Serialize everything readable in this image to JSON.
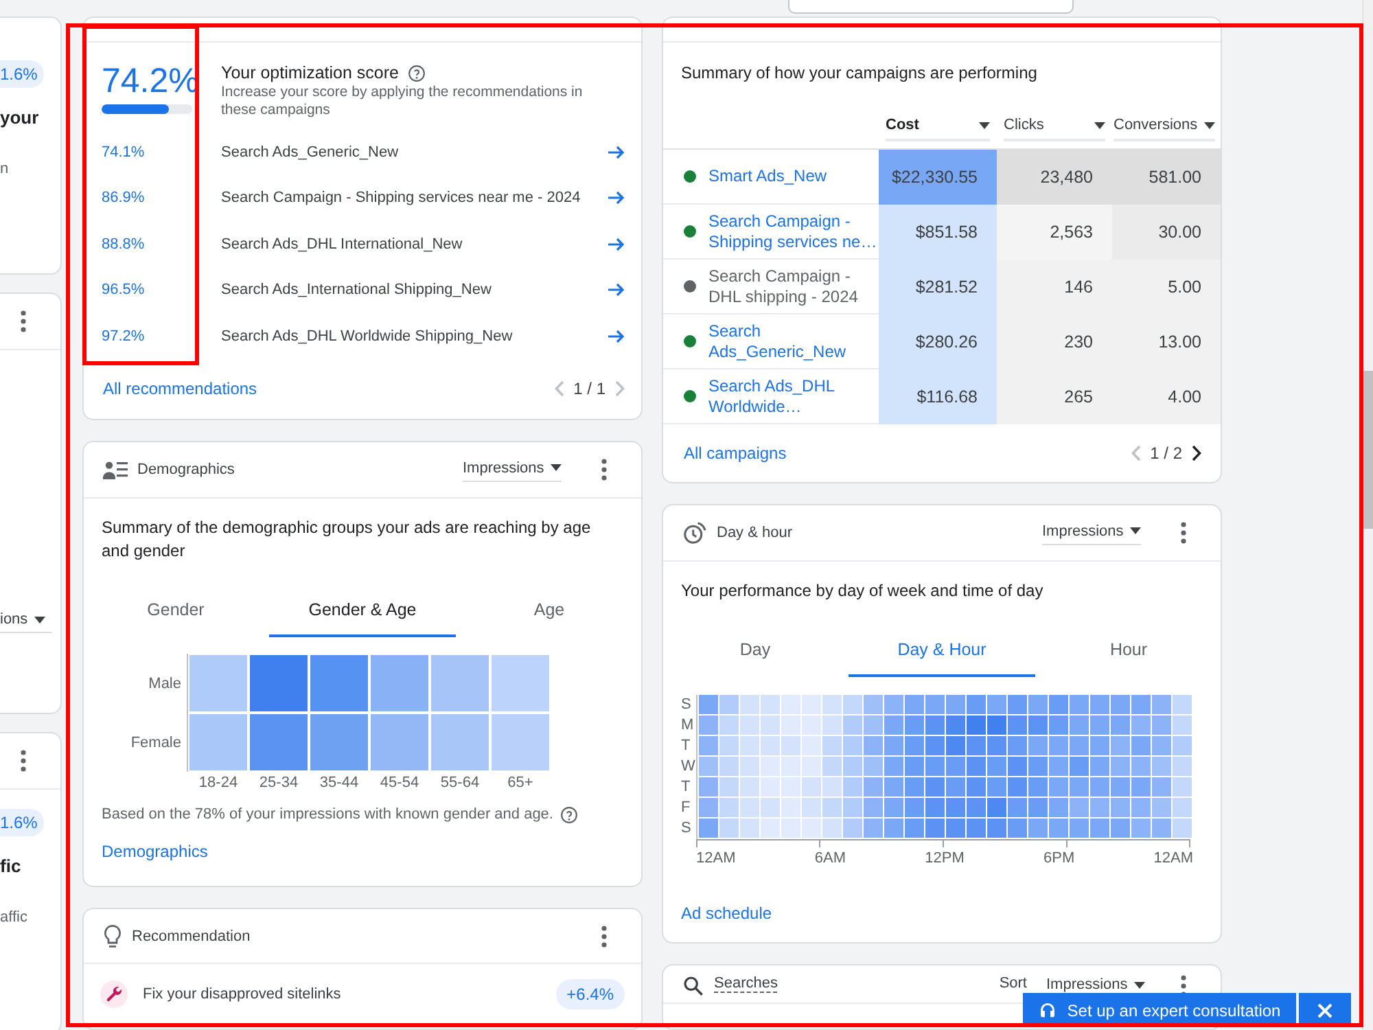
{
  "highlight_frame": true,
  "left_cards": [
    {
      "menu": false,
      "chip": "1.6%",
      "title": "your",
      "text": "n"
    },
    {
      "menu": true,
      "dropdown": "ions"
    },
    {
      "menu": true,
      "chip": "1.6%",
      "title": "fic",
      "text": "affic"
    }
  ],
  "optimization": {
    "score": "74.2%",
    "level": 0.742,
    "score_column_highlighted": true,
    "title": "Your optimization score",
    "subtitle": "Increase your score by applying the recommendations in these campaigns",
    "campaigns": [
      {
        "score": "74.1%",
        "name": "Search Ads_Generic_New"
      },
      {
        "score": "86.9%",
        "name": "Search Campaign - Shipping services near me - 2024"
      },
      {
        "score": "88.8%",
        "name": "Search Ads_DHL International_New"
      },
      {
        "score": "96.5%",
        "name": "Search Ads_International Shipping_New"
      },
      {
        "score": "97.2%",
        "name": "Search Ads_DHL Worldwide Shipping_New"
      }
    ],
    "link": "All recommendations",
    "pager": {
      "text": "1 / 1",
      "prev_disabled": true,
      "next_disabled": true
    }
  },
  "demographics": {
    "title": "Demographics",
    "metric": "Impressions",
    "summary": "Summary of the demographic groups your ads are reaching by age and gender",
    "tabs": [
      {
        "label": "Gender",
        "selected": false
      },
      {
        "label": "Gender & Age",
        "selected": true
      },
      {
        "label": "Age",
        "selected": false
      }
    ],
    "heatmap": {
      "rows": [
        {
          "label": "Male",
          "cells": [
            {
              "color": "#aecbfa"
            },
            {
              "color": "#3f80ee"
            },
            {
              "color": "#5592f1"
            },
            {
              "color": "#89b1f5"
            },
            {
              "color": "#a6c4f8"
            },
            {
              "color": "#bcd4fb"
            }
          ]
        },
        {
          "label": "Female",
          "cells": [
            {
              "color": "#a9c7f9"
            },
            {
              "color": "#5a93f1"
            },
            {
              "color": "#6fa1f3"
            },
            {
              "color": "#94b8f6"
            },
            {
              "color": "#a8c6f8"
            },
            {
              "color": "#b9d1fa"
            }
          ]
        }
      ],
      "columns": [
        "18-24",
        "25-34",
        "35-44",
        "45-54",
        "55-64",
        "65+"
      ]
    },
    "note": "Based on the 78% of your impressions with known gender and age.",
    "link": "Demographics"
  },
  "recommendation": {
    "title": "Recommendation",
    "items": [
      {
        "text": "Fix your disapproved sitelinks",
        "uplift": "+6.4%"
      }
    ]
  },
  "campaigns": {
    "summary": "Summary of how your campaigns are performing",
    "columns": [
      {
        "label": "Cost",
        "sorted": true
      },
      {
        "label": "Clicks",
        "sorted": false
      },
      {
        "label": "Conversions",
        "sorted": false
      }
    ],
    "rows": [
      {
        "name": "Smart Ads_New",
        "color": "#188038",
        "link": true,
        "cells": [
          {
            "value": "$22,330.55",
            "color": "#78a8f5"
          },
          {
            "value": "23,480",
            "color": "#dedede"
          },
          {
            "value": "581.00",
            "color": "#dedede"
          }
        ]
      },
      {
        "name": "Search Campaign - Shipping services ne…",
        "color": "#188038",
        "link": true,
        "cells": [
          {
            "value": "$851.58",
            "color": "#d2e3fc"
          },
          {
            "value": "2,563",
            "color": "#f4f4f4"
          },
          {
            "value": "30.00",
            "color": "#ebebeb"
          }
        ]
      },
      {
        "name": "Search Campaign - DHL shipping - 2024",
        "color": "#5f6368",
        "link": false,
        "cells": [
          {
            "value": "$281.52",
            "color": "#d2e3fc"
          },
          {
            "value": "146",
            "color": "#f1f1f1"
          },
          {
            "value": "5.00",
            "color": "#f1f1f1"
          }
        ]
      },
      {
        "name": "Search Ads_Generic_New",
        "color": "#188038",
        "link": true,
        "cells": [
          {
            "value": "$280.26",
            "color": "#d2e3fc"
          },
          {
            "value": "230",
            "color": "#f1f1f1"
          },
          {
            "value": "13.00",
            "color": "#f1f1f1"
          }
        ]
      },
      {
        "name": "Search Ads_DHL Worldwide…",
        "color": "#188038",
        "link": true,
        "cells": [
          {
            "value": "$116.68",
            "color": "#d2e3fc"
          },
          {
            "value": "265",
            "color": "#f1f1f1"
          },
          {
            "value": "4.00",
            "color": "#f1f1f1"
          }
        ]
      }
    ],
    "link": "All campaigns",
    "pager": {
      "text": "1 / 2",
      "prev_disabled": true,
      "next_disabled": false
    }
  },
  "day_hour": {
    "title": "Day & hour",
    "metric": "Impressions",
    "summary": "Your performance by day of week and time of day",
    "tabs": [
      {
        "label": "Day",
        "selected": false
      },
      {
        "label": "Day & Hour",
        "selected": true
      },
      {
        "label": "Hour",
        "selected": false
      }
    ],
    "heatmap": {
      "rows": [
        {
          "label": "S",
          "cells": [
            {
              "color": "#7aa7f6"
            },
            {
              "color": "#b1cbfa"
            },
            {
              "color": "#d4e2fc"
            },
            {
              "color": "#d4e2fc"
            },
            {
              "color": "#e1ebfd"
            },
            {
              "color": "#e1ebfd"
            },
            {
              "color": "#d4e2fc"
            },
            {
              "color": "#c4d8fb"
            },
            {
              "color": "#9fbff9"
            },
            {
              "color": "#8cb3f8"
            },
            {
              "color": "#7aa7f6"
            },
            {
              "color": "#7aa7f6"
            },
            {
              "color": "#7aa7f6"
            },
            {
              "color": "#699cf5"
            },
            {
              "color": "#7aa7f6"
            },
            {
              "color": "#699cf5"
            },
            {
              "color": "#7aa7f6"
            },
            {
              "color": "#699cf5"
            },
            {
              "color": "#7aa7f6"
            },
            {
              "color": "#7aa7f6"
            },
            {
              "color": "#7aa7f6"
            },
            {
              "color": "#7aa7f6"
            },
            {
              "color": "#8cb3f8"
            },
            {
              "color": "#c4d8fb"
            }
          ]
        },
        {
          "label": "M",
          "cells": [
            {
              "color": "#8cb3f8"
            },
            {
              "color": "#c4d8fb"
            },
            {
              "color": "#d4e2fc"
            },
            {
              "color": "#d4e2fc"
            },
            {
              "color": "#e1ebfd"
            },
            {
              "color": "#e1ebfd"
            },
            {
              "color": "#d4e2fc"
            },
            {
              "color": "#b1cbfa"
            },
            {
              "color": "#9fbff9"
            },
            {
              "color": "#7aa7f6"
            },
            {
              "color": "#699cf5"
            },
            {
              "color": "#5b92f3"
            },
            {
              "color": "#4d89f1"
            },
            {
              "color": "#4081ef"
            },
            {
              "color": "#4081ef"
            },
            {
              "color": "#5b92f3"
            },
            {
              "color": "#5b92f3"
            },
            {
              "color": "#699cf5"
            },
            {
              "color": "#7aa7f6"
            },
            {
              "color": "#7aa7f6"
            },
            {
              "color": "#7aa7f6"
            },
            {
              "color": "#8cb3f8"
            },
            {
              "color": "#8cb3f8"
            },
            {
              "color": "#c4d8fb"
            }
          ]
        },
        {
          "label": "T",
          "cells": [
            {
              "color": "#8cb3f8"
            },
            {
              "color": "#c4d8fb"
            },
            {
              "color": "#d4e2fc"
            },
            {
              "color": "#d4e2fc"
            },
            {
              "color": "#d4e2fc"
            },
            {
              "color": "#e1ebfd"
            },
            {
              "color": "#c4d8fb"
            },
            {
              "color": "#b1cbfa"
            },
            {
              "color": "#8cb3f8"
            },
            {
              "color": "#7aa7f6"
            },
            {
              "color": "#699cf5"
            },
            {
              "color": "#5b92f3"
            },
            {
              "color": "#4d89f1"
            },
            {
              "color": "#5b92f3"
            },
            {
              "color": "#5b92f3"
            },
            {
              "color": "#699cf5"
            },
            {
              "color": "#7aa7f6"
            },
            {
              "color": "#7aa7f6"
            },
            {
              "color": "#7aa7f6"
            },
            {
              "color": "#7aa7f6"
            },
            {
              "color": "#8cb3f8"
            },
            {
              "color": "#7aa7f6"
            },
            {
              "color": "#8cb3f8"
            },
            {
              "color": "#b1cbfa"
            }
          ]
        },
        {
          "label": "W",
          "cells": [
            {
              "color": "#9fbff9"
            },
            {
              "color": "#c4d8fb"
            },
            {
              "color": "#d4e2fc"
            },
            {
              "color": "#e1ebfd"
            },
            {
              "color": "#e1ebfd"
            },
            {
              "color": "#e1ebfd"
            },
            {
              "color": "#c4d8fb"
            },
            {
              "color": "#b1cbfa"
            },
            {
              "color": "#9fbff9"
            },
            {
              "color": "#7aa7f6"
            },
            {
              "color": "#699cf5"
            },
            {
              "color": "#699cf5"
            },
            {
              "color": "#699cf5"
            },
            {
              "color": "#5b92f3"
            },
            {
              "color": "#699cf5"
            },
            {
              "color": "#5b92f3"
            },
            {
              "color": "#699cf5"
            },
            {
              "color": "#7aa7f6"
            },
            {
              "color": "#699cf5"
            },
            {
              "color": "#7aa7f6"
            },
            {
              "color": "#8cb3f8"
            },
            {
              "color": "#8cb3f8"
            },
            {
              "color": "#9fbff9"
            },
            {
              "color": "#c4d8fb"
            }
          ]
        },
        {
          "label": "T",
          "cells": [
            {
              "color": "#8cb3f8"
            },
            {
              "color": "#c4d8fb"
            },
            {
              "color": "#d4e2fc"
            },
            {
              "color": "#e1ebfd"
            },
            {
              "color": "#e1ebfd"
            },
            {
              "color": "#d4e2fc"
            },
            {
              "color": "#d4e2fc"
            },
            {
              "color": "#b1cbfa"
            },
            {
              "color": "#8cb3f8"
            },
            {
              "color": "#7aa7f6"
            },
            {
              "color": "#699cf5"
            },
            {
              "color": "#5b92f3"
            },
            {
              "color": "#699cf5"
            },
            {
              "color": "#5b92f3"
            },
            {
              "color": "#699cf5"
            },
            {
              "color": "#5b92f3"
            },
            {
              "color": "#699cf5"
            },
            {
              "color": "#7aa7f6"
            },
            {
              "color": "#7aa7f6"
            },
            {
              "color": "#7aa7f6"
            },
            {
              "color": "#7aa7f6"
            },
            {
              "color": "#7aa7f6"
            },
            {
              "color": "#8cb3f8"
            },
            {
              "color": "#c4d8fb"
            }
          ]
        },
        {
          "label": "F",
          "cells": [
            {
              "color": "#8cb3f8"
            },
            {
              "color": "#c4d8fb"
            },
            {
              "color": "#d4e2fc"
            },
            {
              "color": "#d4e2fc"
            },
            {
              "color": "#e1ebfd"
            },
            {
              "color": "#d4e2fc"
            },
            {
              "color": "#c4d8fb"
            },
            {
              "color": "#b1cbfa"
            },
            {
              "color": "#8cb3f8"
            },
            {
              "color": "#7aa7f6"
            },
            {
              "color": "#699cf5"
            },
            {
              "color": "#5b92f3"
            },
            {
              "color": "#5b92f3"
            },
            {
              "color": "#5b92f3"
            },
            {
              "color": "#4d89f1"
            },
            {
              "color": "#699cf5"
            },
            {
              "color": "#699cf5"
            },
            {
              "color": "#7aa7f6"
            },
            {
              "color": "#8cb3f8"
            },
            {
              "color": "#8cb3f8"
            },
            {
              "color": "#8cb3f8"
            },
            {
              "color": "#8cb3f8"
            },
            {
              "color": "#9fbff9"
            },
            {
              "color": "#c4d8fb"
            }
          ]
        },
        {
          "label": "S",
          "cells": [
            {
              "color": "#7aa7f6"
            },
            {
              "color": "#c4d8fb"
            },
            {
              "color": "#d4e2fc"
            },
            {
              "color": "#e1ebfd"
            },
            {
              "color": "#e1ebfd"
            },
            {
              "color": "#e1ebfd"
            },
            {
              "color": "#d4e2fc"
            },
            {
              "color": "#b1cbfa"
            },
            {
              "color": "#8cb3f8"
            },
            {
              "color": "#7aa7f6"
            },
            {
              "color": "#699cf5"
            },
            {
              "color": "#5b92f3"
            },
            {
              "color": "#5b92f3"
            },
            {
              "color": "#5b92f3"
            },
            {
              "color": "#5b92f3"
            },
            {
              "color": "#699cf5"
            },
            {
              "color": "#7aa7f6"
            },
            {
              "color": "#7aa7f6"
            },
            {
              "color": "#7aa7f6"
            },
            {
              "color": "#7aa7f6"
            },
            {
              "color": "#7aa7f6"
            },
            {
              "color": "#8cb3f8"
            },
            {
              "color": "#8cb3f8"
            },
            {
              "color": "#c4d8fb"
            }
          ]
        }
      ],
      "ticks": [
        "12AM",
        "6AM",
        "12PM",
        "6PM",
        "12AM"
      ]
    },
    "link": "Ad schedule"
  },
  "searches": {
    "title": "Searches",
    "sort_label": "Sort",
    "sort_value": "Impressions"
  },
  "consultation": {
    "label": "Set up an expert consultation"
  }
}
